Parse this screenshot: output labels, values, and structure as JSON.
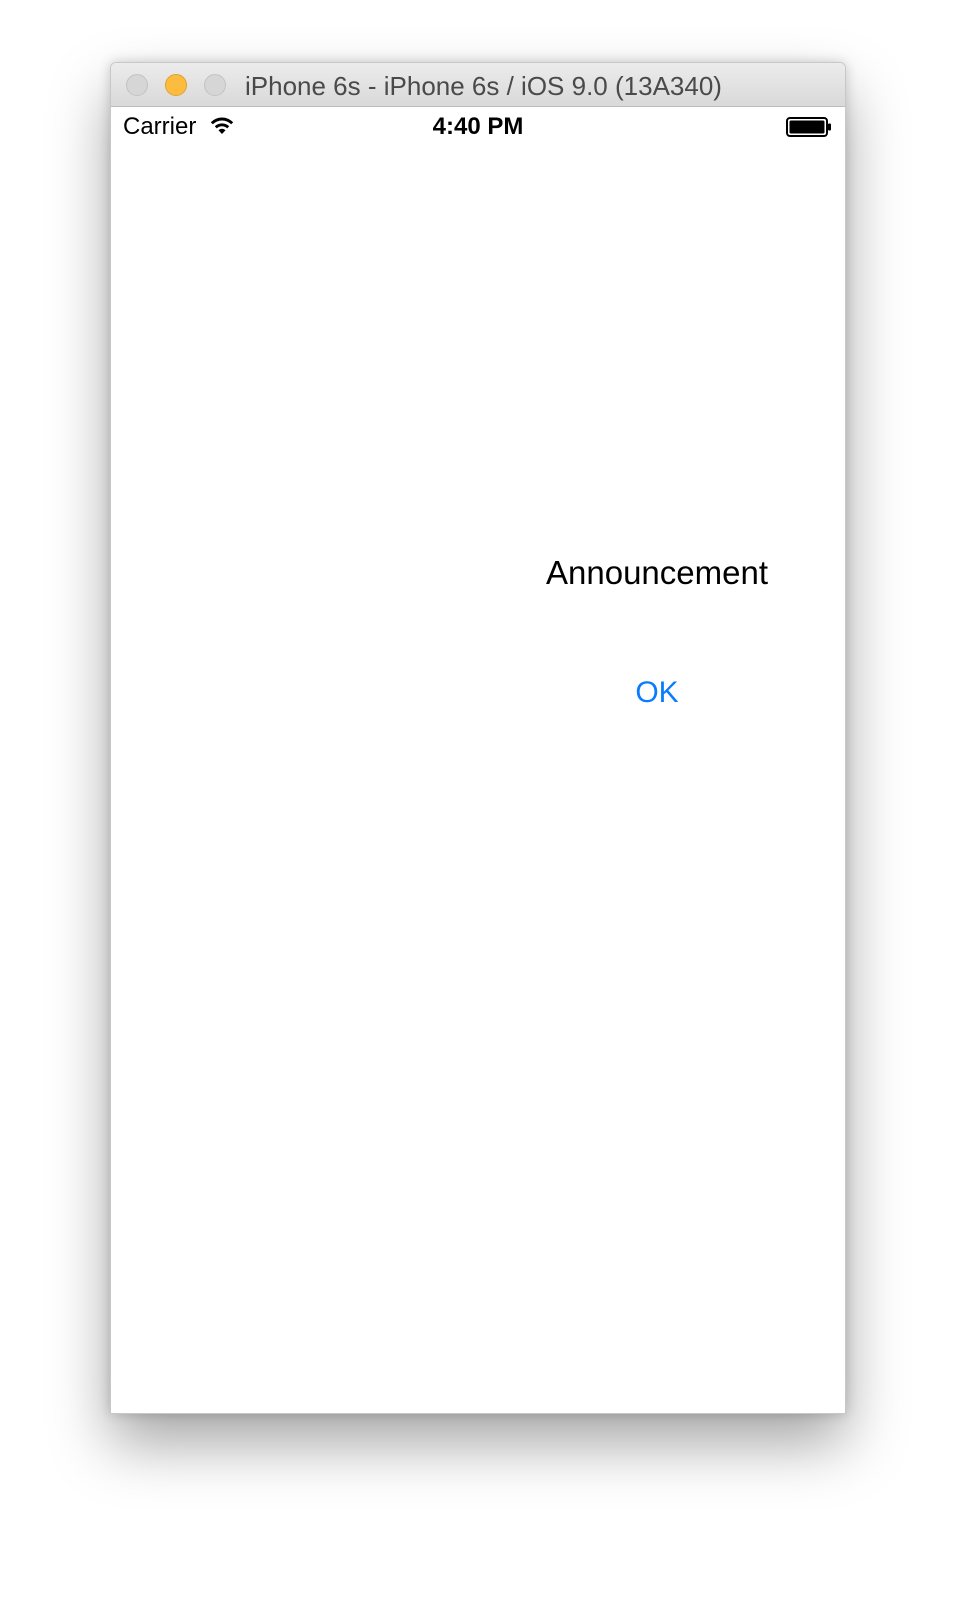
{
  "window": {
    "title": "iPhone 6s - iPhone 6s / iOS 9.0 (13A340)",
    "controls": [
      "close",
      "minimize",
      "zoom"
    ]
  },
  "status_bar": {
    "carrier": "Carrier",
    "time": "4:40 PM",
    "icons": [
      "wifi-icon",
      "battery-icon"
    ]
  },
  "content": {
    "announcement_label": "Announcement",
    "ok_button_label": "OK"
  },
  "colors": {
    "button_tint": "#0a7bff",
    "minimize_button": "#fdbc40"
  }
}
